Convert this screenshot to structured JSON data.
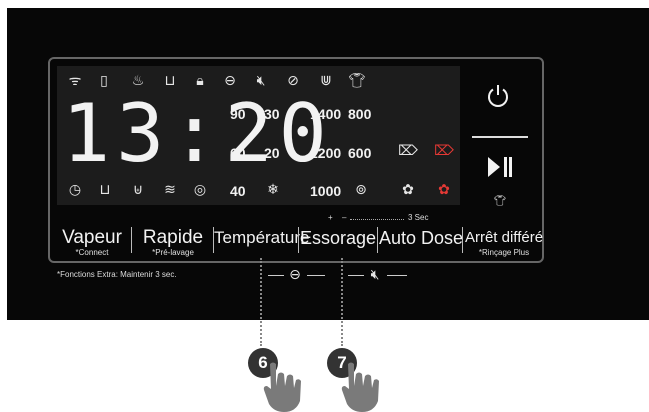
{
  "display": {
    "time": "13:20",
    "status_icons_top": [
      "wifi-icon",
      "phone-icon",
      "steam-icon",
      "tub-icon",
      "lock-icon",
      "no-crease-icon",
      "mute-icon",
      "timer-icon",
      "basin-icon",
      "shirt-icon"
    ],
    "status_icons_bottom": [
      "clock-icon",
      "prewash-icon",
      "main-wash-icon",
      "rinse-icon",
      "spin-icon"
    ],
    "temperatures": [
      "90",
      "30",
      "60",
      "20",
      "40"
    ],
    "spin_speeds": [
      "1400",
      "800",
      "1200",
      "600",
      "1000"
    ]
  },
  "buttons": {
    "vapeur": "Vapeur",
    "vapeur_sub": "*Connect",
    "rapide": "Rapide",
    "rapide_sub": "*Pré-lavage",
    "temperature": "Température",
    "essorage": "Essorage",
    "auto_dose": "Auto Dose",
    "arret": "Arrêt différé",
    "arret_sub": "*Rinçage Plus"
  },
  "combo_hint": {
    "plus": "+",
    "minus": "–",
    "duration": "3 Sec"
  },
  "footnote": "*Fonctions Extra: Maintenir 3 sec.",
  "steps": {
    "step6": "6",
    "step7": "7"
  },
  "colors": {
    "panel": "#070707",
    "display": "#1c1c1c",
    "accent_red": "#e53935",
    "badge": "#333333",
    "hand": "#7a7a7a"
  }
}
